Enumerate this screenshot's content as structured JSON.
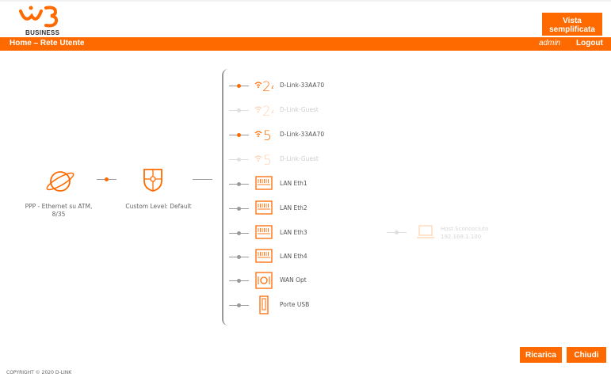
{
  "header": {
    "logo_subtitle": "BUSINESS",
    "vista_button_line1": "Vista",
    "vista_button_line2": "semplificata"
  },
  "navbar": {
    "title": "Home – Rete Utente",
    "user": "admin",
    "logout": "Logout"
  },
  "topology": {
    "wan_label_line1": "PPP - Ethernet su ATM,",
    "wan_label_line2": "8/35",
    "firewall_label": "Custom Level: Default",
    "items": [
      {
        "label": "D-Link-33AA70",
        "icon": "wifi-2.4ghz-icon",
        "band": "24",
        "active": true
      },
      {
        "label": "D-Link-Guest",
        "icon": "wifi-2.4ghz-icon",
        "band": "24",
        "active": false
      },
      {
        "label": "D-Link-33AA70",
        "icon": "wifi-5ghz-icon",
        "band": "5",
        "active": true
      },
      {
        "label": "D-Link-Guest",
        "icon": "wifi-5ghz-icon",
        "band": "5",
        "active": false
      },
      {
        "label": "LAN Eth1",
        "icon": "ethernet-port-icon",
        "active": true
      },
      {
        "label": "LAN Eth2",
        "icon": "ethernet-port-icon",
        "active": true
      },
      {
        "label": "LAN Eth3",
        "icon": "ethernet-port-icon",
        "active": true
      },
      {
        "label": "LAN Eth4",
        "icon": "ethernet-port-icon",
        "active": true
      },
      {
        "label": "WAN Opt",
        "icon": "wan-optical-port-icon",
        "active": true
      },
      {
        "label": "Porte USB",
        "icon": "usb-port-icon",
        "active": true
      }
    ],
    "host_label": "Host Sconosciuto",
    "host_ip": "192.168.1.100"
  },
  "buttons": {
    "reload": "Ricarica",
    "close": "Chiudi"
  },
  "footer": {
    "copyright": "COPYRIGHT © 2020 D-LINK"
  },
  "colors": {
    "accent": "#ff6a00",
    "line": "#999999"
  }
}
